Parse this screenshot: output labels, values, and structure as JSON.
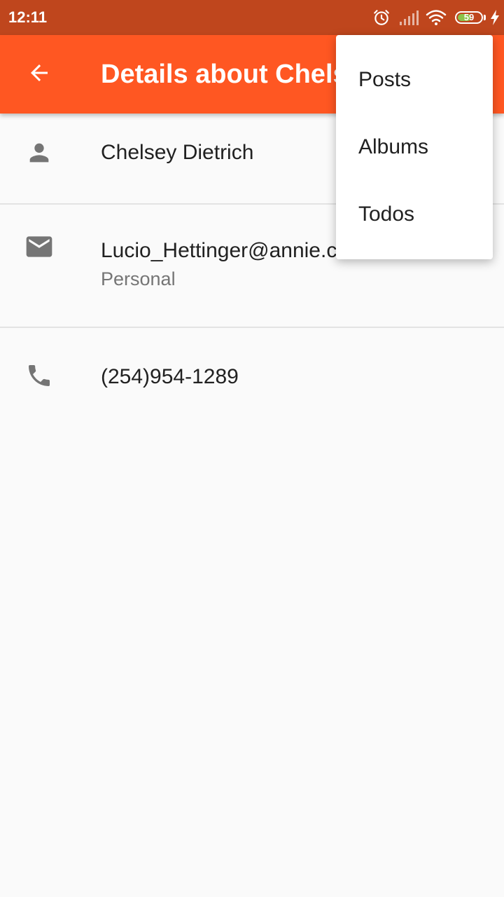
{
  "status_bar": {
    "time": "12:11",
    "battery": "59",
    "battery_level": 0.59,
    "icons": [
      "alarm-icon",
      "signal-icon",
      "wifi-icon",
      "battery-icon",
      "charging-icon"
    ]
  },
  "app_bar": {
    "title": "Details about Chelsey Dietrich",
    "background": "#ff5722",
    "back_icon": "arrow-back-icon"
  },
  "details": {
    "name": "Chelsey Dietrich",
    "email": "Lucio_Hettinger@annie.ca",
    "email_label": "Personal",
    "phone": "(254)954-1289"
  },
  "menu": {
    "items": [
      "Posts",
      "Albums",
      "Todos"
    ]
  },
  "colors": {
    "status_bar": "#bf461d",
    "accent": "#ff5722",
    "icon_grey": "#757575"
  }
}
